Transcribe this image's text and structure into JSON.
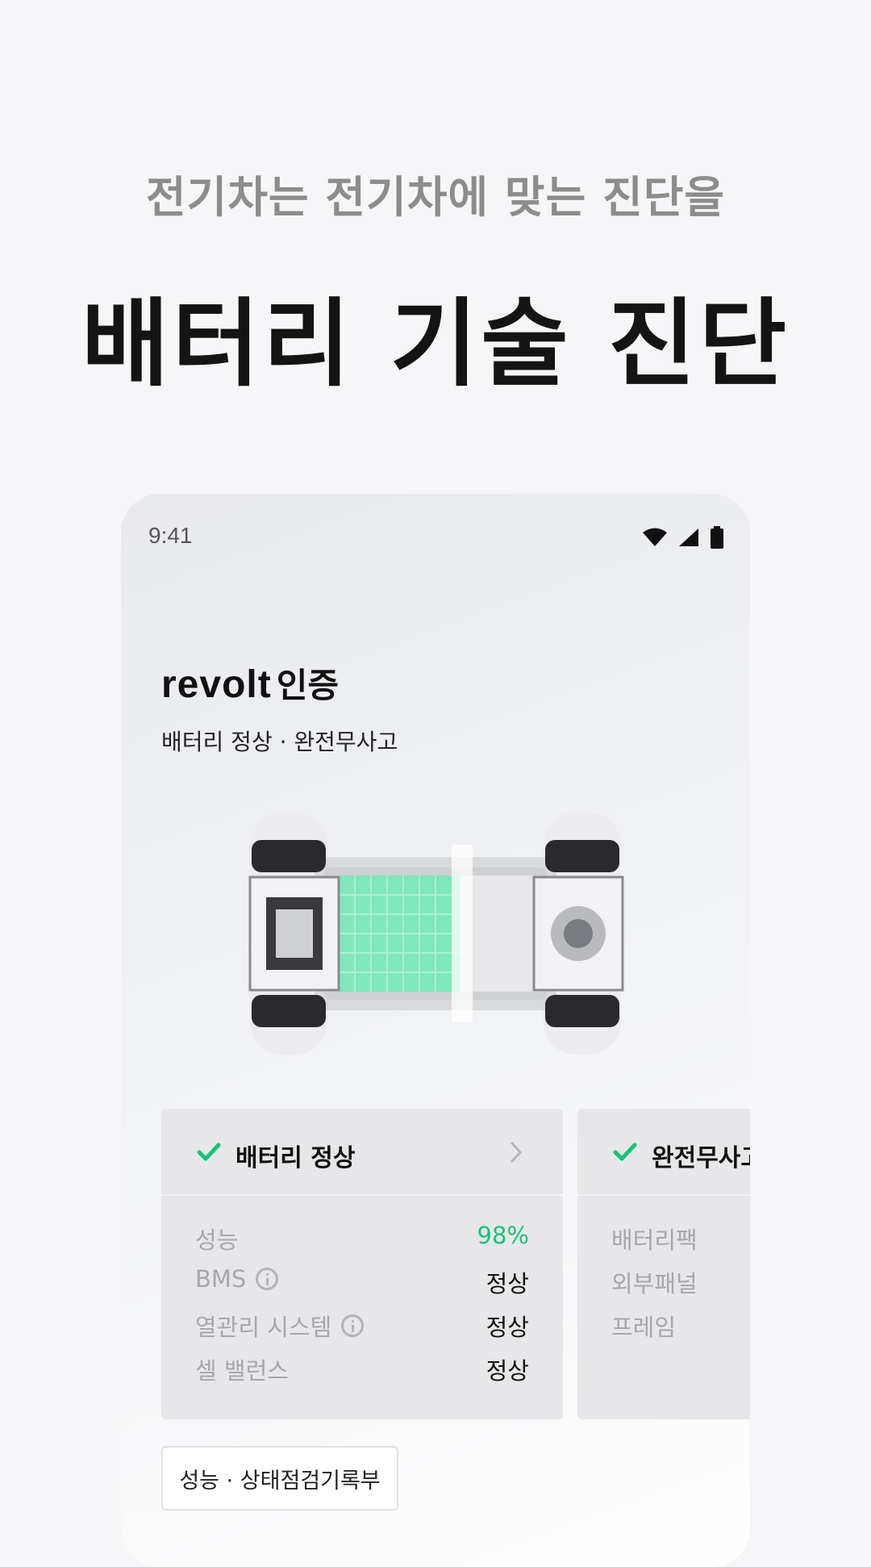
{
  "hero": {
    "subtitle": "전기차는 전기차에 맞는 진단을",
    "title": "배터리 기술 진단"
  },
  "phone": {
    "status_time": "9:41",
    "status_icons": [
      "wifi-icon",
      "cellular-signal-icon",
      "battery-icon"
    ],
    "brand_logo": "revolt",
    "brand_cert": "인증",
    "subtitle": "배터리 정상 · 완전무사고"
  },
  "cards": [
    {
      "title": "배터리 정상",
      "rows": [
        {
          "label": "성능",
          "value": "98%",
          "info": false
        },
        {
          "label": "BMS",
          "value": "정상",
          "info": true
        },
        {
          "label": "열관리 시스템",
          "value": "정상",
          "info": true
        },
        {
          "label": "셀 밸런스",
          "value": "정상",
          "info": false
        }
      ]
    },
    {
      "title": "완전무사고",
      "rows": [
        {
          "label": "배터리팩"
        },
        {
          "label": "외부패널"
        },
        {
          "label": "프레임"
        }
      ]
    }
  ],
  "record_button": "성능 · 상태점검기록부",
  "colors": {
    "accent_green": "#1bc27a",
    "battery_cells": "#6fe3b5"
  }
}
